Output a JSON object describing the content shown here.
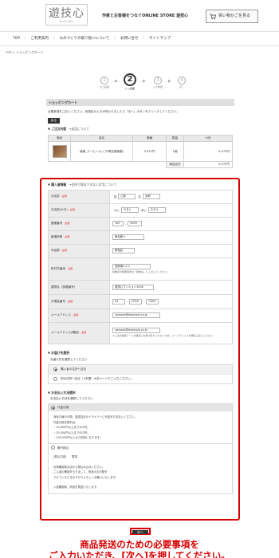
{
  "header": {
    "logo_main": "遊技心",
    "logo_sub": "Yu-Gi Shin",
    "tagline": "作家とお客様をつなぐONLINE STORE 遊技心",
    "cart_label": "買い物かごを見る",
    "cart_icon": "cart-icon"
  },
  "gnav": [
    "TOP",
    "ご利用案内",
    "ものづくりの取り扱いについて",
    "お問い合せ",
    "サイトマップ"
  ],
  "breadcrumb": "TOP > ショッピングカート",
  "steps": [
    {
      "num": "1",
      "label": "カゴ画面"
    },
    {
      "num": "2",
      "label": "レジ画面"
    },
    {
      "num": "3",
      "label": "入力確認"
    },
    {
      "num": "4",
      "label": "完了"
    }
  ],
  "section_title": "ショッピングカート",
  "intro_text": "必要事項をご記入ください。各項目の入力が終わりましたら「次へ」ボタンをクリックしてください。",
  "back_label": "戻る",
  "order": {
    "heading": "▼ ご注文内容",
    "heading_note": "→送品について",
    "headers": [
      "商品",
      "品名",
      "価格",
      "数量",
      "小計"
    ],
    "item_name": "焼締_コーヒーカップ(陶芸家藤森)",
    "item_price": "9,072円",
    "item_qty": "1個",
    "item_subtotal": "9,072円",
    "total_label": "商品合計",
    "total_value": "9,072円"
  },
  "purchaser": {
    "title": "▼ 購入者情報",
    "title_note": "→住所で保存できない文字について",
    "required_mark": "必須",
    "name_label": "お名前",
    "sei_label": "姓",
    "sei_value": "山本",
    "mei_label": "名",
    "mei_value": "太郎",
    "kana_label": "お名前(かな)",
    "kana_sei_label": "せい",
    "kana_sei_value": "やまと",
    "kana_mei_label": "めい",
    "kana_mei_value": "たろう",
    "zip_label": "郵便番号",
    "zip1": "100",
    "zip2": "0000",
    "pref_label": "都道府県",
    "pref_value": "東京都",
    "city_label": "市区郡",
    "city_value": "新宿区",
    "street_label": "町村字番地",
    "street_value": "西新宿1-2-1",
    "street_hint": "建物名や部屋番号は「建物名」に入力してください",
    "bldg_label": "建物名（部屋番号）",
    "bldg_value": "遊技心マンション1004",
    "tel_label": "お電話番号",
    "tel1": "03",
    "tel2": "0000",
    "tel3": "0000",
    "mail_label": "メールアドレス",
    "mail_value": "yamada@example.co.jp",
    "mail2_label": "メールアドレス(確認)",
    "mail2_value": "yamada@example.co.jp",
    "mail2_hint": "※ご注文確認メールを確実にお受け取りいただくため、メールアドレスを再度ご記入ください。"
  },
  "delivery": {
    "title": "▼ お届け先選択",
    "subtitle": "お届け先を選択してください",
    "opt1": "購入者の住所へ送る",
    "opt2": "別の住所へ送る（1本便）※次ページでご入力ください。"
  },
  "payment": {
    "title": "▼ お支払い方法選択",
    "subtitle": "お支払い方法を選択してください",
    "cod_label": "代金引換",
    "cod_lines": [
      "商品お届けの際、運送会社のドライバーに代金をお支払いください。",
      "代金引換手数料は、",
      "・10,800円以上まで324円。",
      "・30,000円以上まで432円。",
      "・100,000円以上から別料になります。"
    ],
    "bank_label": "銀行振込",
    "bank_lines": [
      "[振込口座]　　要項",
      "",
      "出荷確認後お店から振込み込みください。",
      "ご入金の確認をもちまして、商品のお手配を",
      "させていただきますのでよろしくお願いいたします。",
      "",
      "入金確認後、商品を発送いたします。"
    ]
  },
  "next_label": "次へ",
  "caption_line1": "商品発送のための必要事項を",
  "caption_line2": "ご入力いただき、[次へ]を押してください。"
}
